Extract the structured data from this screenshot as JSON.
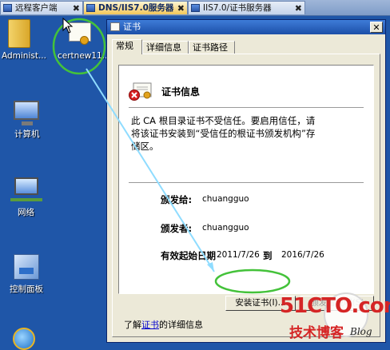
{
  "tabs": [
    {
      "label": "远程客户端",
      "active": false
    },
    {
      "label": "DNS/IIS7.0服务器",
      "active": true
    },
    {
      "label": "IIS7.0/证书服务器",
      "active": false
    }
  ],
  "tab_close": "✖",
  "desktop": {
    "icons": [
      {
        "label": "Administ...",
        "icon": "folder-icon"
      },
      {
        "label": "certnew11...",
        "icon": "certificate-icon"
      },
      {
        "label": "计算机",
        "icon": "computer-icon"
      },
      {
        "label": "网络",
        "icon": "network-icon"
      },
      {
        "label": "控制面板",
        "icon": "control-panel-icon"
      }
    ]
  },
  "dialog": {
    "title": "证书",
    "close": "✕",
    "tabs": [
      "常规",
      "详细信息",
      "证书路径"
    ],
    "info_title": "证书信息",
    "description": "此 CA 根目录证书不受信任。要启用信任，请将该证书安装到“受信任的根证书颁发机构”存储区。",
    "issued_to_label": "颁发给:",
    "issued_to_value": "chuangguo",
    "issued_by_label": "颁发者:",
    "issued_by_value": "chuangguo",
    "valid_from_label": "有效起始日期",
    "valid_from": "2011/7/26",
    "valid_to_word": "到",
    "valid_to": "2016/7/26",
    "install_button": "安装证书(I)...",
    "issuer_statement_button": "颁发者说明(S)",
    "learn_more_prefix": "了解",
    "learn_more_link": "证书",
    "learn_more_suffix": "的详细信息"
  },
  "watermark": {
    "site": "51CTO.com",
    "tagline": "技术博客",
    "blog": "Blog"
  },
  "colors": {
    "desktop": "#1f56a8",
    "dialog_face": "#ece9d8",
    "titlebar": "#1c4fa8",
    "highlight": "#44c23a",
    "arrow": "#8fdcff",
    "watermark": "#d52525"
  }
}
